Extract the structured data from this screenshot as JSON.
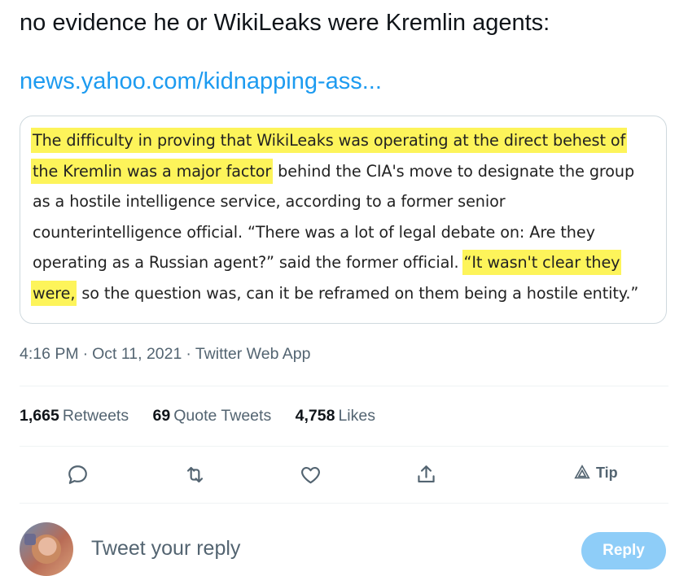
{
  "tweet": {
    "text_line1": "no evidence he or WikiLeaks were Kremlin agents:",
    "link": "news.yahoo.com/kidnapping-ass..."
  },
  "quote": {
    "line1_hl": "The difficulty in proving that WikiLeaks was operating at the direct behest of",
    "line2_hl": "the Kremlin was a major factor",
    "line2_rest": " behind the CIA's move to designate the group",
    "line3": "as a hostile intelligence service, according to a former senior",
    "line4": "counterintelligence official. “There was a lot of legal debate on: Are they",
    "line5_pre": "operating as a Russian agent?” said the former official. ",
    "line5_hl": "“It wasn't clear they",
    "line6_hl": "were,",
    "line6_rest": " so the question was, can it be reframed on them being a hostile entity.”",
    "highlight_color": "#fdf45a"
  },
  "meta": {
    "time": "4:16 PM",
    "sep1": "·",
    "date": "Oct 11, 2021",
    "sep2": "·",
    "source": "Twitter Web App"
  },
  "stats": {
    "retweets_count": "1,665",
    "retweets_label": "Retweets",
    "quotes_count": "69",
    "quotes_label": "Quote Tweets",
    "likes_count": "4,758",
    "likes_label": "Likes"
  },
  "actions": {
    "icons": [
      "reply-icon",
      "retweet-icon",
      "like-icon",
      "share-icon",
      "tip-icon"
    ],
    "tip_label": "Tip"
  },
  "reply": {
    "placeholder": "Tweet your reply",
    "button_label": "Reply"
  },
  "colors": {
    "link": "#1d9bf0",
    "secondary_text": "#536471",
    "reply_button": "#8ecdf8"
  }
}
